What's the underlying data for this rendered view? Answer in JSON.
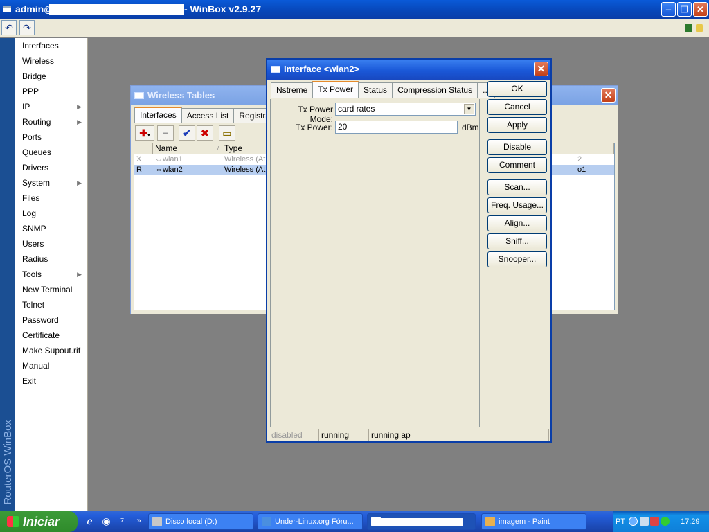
{
  "titlebar": {
    "prefix": "admin@",
    "suffix": "- WinBox v2.9.27"
  },
  "brand": "RouterOS WinBox",
  "menu": [
    {
      "label": "Interfaces",
      "sub": false
    },
    {
      "label": "Wireless",
      "sub": false
    },
    {
      "label": "Bridge",
      "sub": false
    },
    {
      "label": "PPP",
      "sub": false
    },
    {
      "label": "IP",
      "sub": true
    },
    {
      "label": "Routing",
      "sub": true
    },
    {
      "label": "Ports",
      "sub": false
    },
    {
      "label": "Queues",
      "sub": false
    },
    {
      "label": "Drivers",
      "sub": false
    },
    {
      "label": "System",
      "sub": true
    },
    {
      "label": "Files",
      "sub": false
    },
    {
      "label": "Log",
      "sub": false
    },
    {
      "label": "SNMP",
      "sub": false
    },
    {
      "label": "Users",
      "sub": false
    },
    {
      "label": "Radius",
      "sub": false
    },
    {
      "label": "Tools",
      "sub": true
    },
    {
      "label": "New Terminal",
      "sub": false
    },
    {
      "label": "Telnet",
      "sub": false
    },
    {
      "label": "Password",
      "sub": false
    },
    {
      "label": "Certificate",
      "sub": false
    },
    {
      "label": "Make Supout.rif",
      "sub": false
    },
    {
      "label": "Manual",
      "sub": false
    },
    {
      "label": "Exit",
      "sub": false
    }
  ],
  "wireless_tables": {
    "title": "Wireless Tables",
    "tabs": [
      "Interfaces",
      "Access List",
      "Registration"
    ],
    "columns": [
      "Name",
      "Type"
    ],
    "rows": [
      {
        "flag": "X",
        "name": "⇔wlan1",
        "type": "Wireless (Ath",
        "extra": "2"
      },
      {
        "flag": "R",
        "name": "⇔wlan2",
        "type": "Wireless (Ath",
        "extra": "o1"
      }
    ]
  },
  "dialog": {
    "title": "Interface <wlan2>",
    "tabs": [
      "Nstreme",
      "Tx Power",
      "Status",
      "Compression Status",
      "..."
    ],
    "fields": {
      "tx_power_mode_label": "Tx Power Mode:",
      "tx_power_mode_value": "card rates",
      "tx_power_label": "Tx Power:",
      "tx_power_value": "20",
      "tx_power_unit": "dBm"
    },
    "buttons": [
      "OK",
      "Cancel",
      "Apply",
      "Disable",
      "Comment",
      "Scan...",
      "Freq. Usage...",
      "Align...",
      "Sniff...",
      "Snooper..."
    ],
    "status": [
      "disabled",
      "running",
      "running ap"
    ]
  },
  "taskbar": {
    "start": "Iniciar",
    "tasks": [
      {
        "label": "Disco local (D:)",
        "icon_color": "#c8c8c8"
      },
      {
        "label": "Under-Linux.org Fóru...",
        "icon_color": "#4a8fe0"
      },
      {
        "label": "",
        "icon_color": "#ffffff"
      },
      {
        "label": "imagem - Paint",
        "icon_color": "#e8b050"
      }
    ],
    "lang": "PT",
    "clock": "17:29"
  },
  "colors": {
    "accent": "#e68b2c",
    "selection": "#b7cef0",
    "titlebar": "#0a5ad8"
  }
}
